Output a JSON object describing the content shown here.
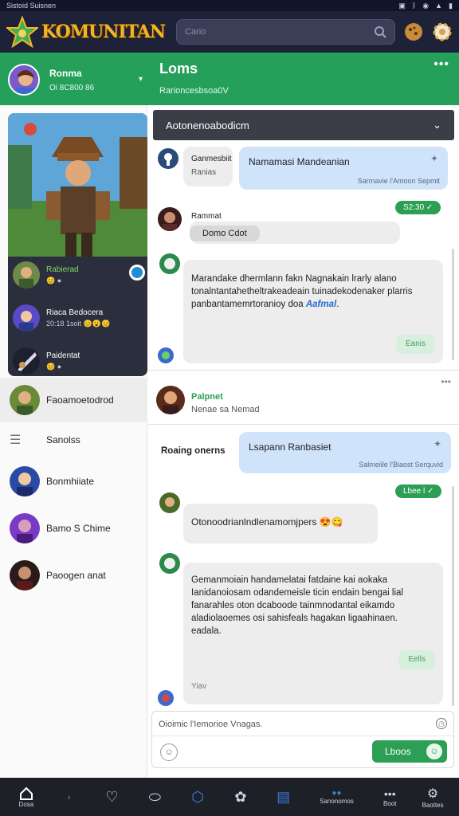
{
  "statusbar": {
    "left_text": "Sistoid Suisnen",
    "icons": [
      "image-icon",
      "bluetooth-icon",
      "wifi-icon",
      "signal-icon",
      "battery-icon"
    ]
  },
  "topbar": {
    "logo_text": "KOMUNITAN",
    "search_placeholder": "Cario",
    "icons": [
      "search-icon",
      "cookie-icon",
      "gear-icon"
    ]
  },
  "header": {
    "user_name": "Ronma",
    "user_sub": "Oi 8C800 86",
    "channel_title": "Loms",
    "channel_sub": "Rarioncesbsoa0V"
  },
  "sidebar": {
    "friends": [
      {
        "name": "Rabierad",
        "sub": "",
        "online": true
      },
      {
        "name": "Riaca Bedocera",
        "sub": "20:18 1soit"
      },
      {
        "name": "Paidentat",
        "sub": ""
      }
    ],
    "items": [
      {
        "label": "Faoamoetodrod"
      },
      {
        "label": "Sanolss"
      },
      {
        "label": "Bonmhiiate"
      },
      {
        "label": "Bamo S Chime"
      },
      {
        "label": "Paoogen anat"
      }
    ]
  },
  "chat": {
    "section_title": "Aotonenoabodicm",
    "messages": [
      {
        "sender": "Ganmesbiit",
        "sender_sub": "Ranias",
        "text": "Namamasi Mandeanian",
        "meta": "Sarmavie l'Amoon Sepmit"
      },
      {
        "badge": "S2:30 ✓"
      },
      {
        "sender": "Rammat",
        "text": "Domo Cdot"
      },
      {
        "text_lines": [
          "Marandake dhermlann fakn Nagnakain lrarly alano",
          "tonalntantahetheltrakeadeain tuinadekodenaker plarris",
          "panbantamemrtoranioy doa "
        ],
        "link": "Aafmal",
        "suffix": ".",
        "button": "Eanis"
      },
      {
        "sender": "Palpnet",
        "sender_sub": "Nenae sa Nemad"
      },
      {
        "left_label": "Roaing onerns",
        "text": "Lsapann Ranbasiet",
        "meta": "Salmeiile l'Biaost Serquvid"
      },
      {
        "badge": "Lbee l ✓"
      },
      {
        "text": "Otonoodrianlndlenamomjpers"
      },
      {
        "text_lines": [
          "Gemanmoiain handamelatai fatdaine kai aokaka",
          "Ianidanoiosam odandemeisle ticin endain bengai lial",
          "fanarahles oton dcaboode tainmnodantal eikamdo",
          "aladiolaoemes osi sahisfeals hagakan ligaahinaen.",
          "eadala."
        ],
        "button": "Eells",
        "foot": "Yiav"
      }
    ],
    "input_placeholder": "Oioimic l'Iemorioe Vnagas.",
    "send_label": "Lboos"
  },
  "bottomnav": {
    "items": [
      {
        "icon": "home-icon",
        "label": "Dosa"
      },
      {
        "icon": "chevron-icon",
        "label": ""
      },
      {
        "icon": "heart-icon",
        "label": ""
      },
      {
        "icon": "pill-icon",
        "label": ""
      },
      {
        "icon": "shield-icon",
        "label": ""
      },
      {
        "icon": "gamepad-icon",
        "label": ""
      },
      {
        "icon": "chat-icon",
        "label": ""
      },
      {
        "icon": "profile-icon",
        "label": "Sanonomos"
      },
      {
        "icon": "more-icon",
        "label": "Boot"
      },
      {
        "icon": "gear-icon",
        "label": "Baottes"
      }
    ]
  }
}
